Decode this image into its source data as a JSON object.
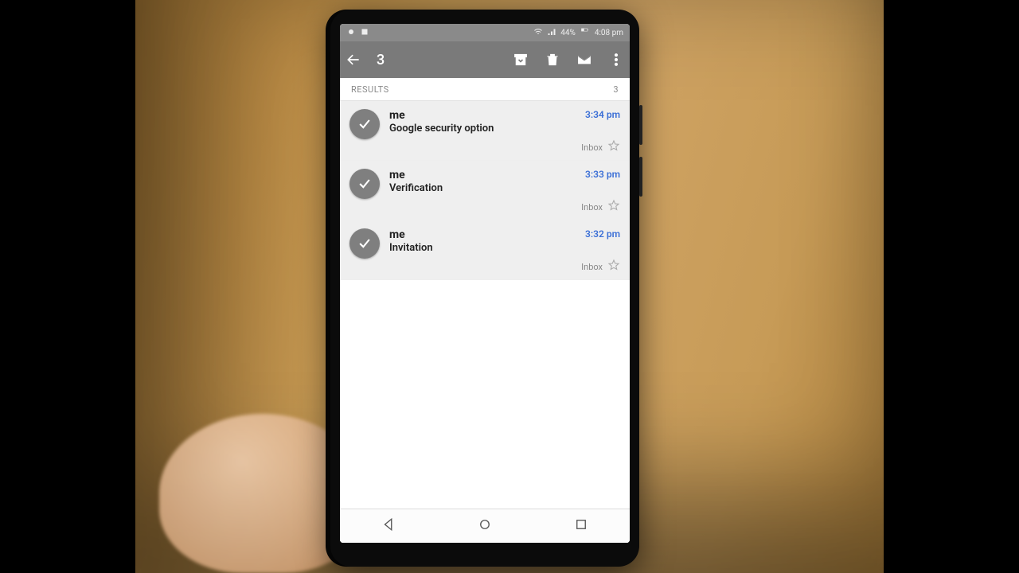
{
  "statusbar": {
    "battery": "44%",
    "time": "4:08 pm"
  },
  "toolbar": {
    "selected_count": "3"
  },
  "results": {
    "label": "RESULTS",
    "count": "3"
  },
  "emails": [
    {
      "sender": "me",
      "subject": "Google security option",
      "time": "3:34 pm",
      "label": "Inbox"
    },
    {
      "sender": "me",
      "subject": "Verification",
      "time": "3:33 pm",
      "label": "Inbox"
    },
    {
      "sender": "me",
      "subject": "Invitation",
      "time": "3:32 pm",
      "label": "Inbox"
    }
  ]
}
